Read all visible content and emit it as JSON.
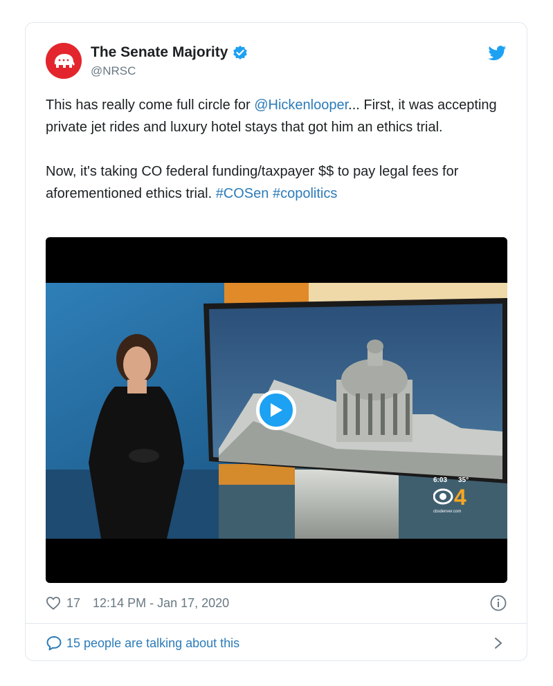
{
  "author": {
    "name": "The Senate Majority",
    "handle": "@NRSC",
    "avatar_icon": "elephant-logo-icon",
    "brand_color": "#e3262d",
    "verified": true
  },
  "tweet": {
    "paragraph1": {
      "before": "This has really come full circle for ",
      "mention": "@Hickenlooper",
      "after": "... First, it was accepting private jet rides and luxury hotel stays that got him an ethics trial."
    },
    "paragraph2": {
      "before": "Now, it's taking CO federal funding/taxpayer $$ to pay legal fees for aforementioned ethics trial. ",
      "hashtag1": "#COSen",
      "hashtag2": "#copolitics"
    },
    "link_color": "#2b7bb9"
  },
  "media": {
    "type": "video",
    "play_icon": "play-icon",
    "station_bug": {
      "time": "6:03",
      "temperature": "35°",
      "logo": "CBS4",
      "site": "cbsdenver.com"
    }
  },
  "footer": {
    "likes": "17",
    "timestamp": "12:14 PM - Jan 17, 2020",
    "conversation": "15 people are talking about this"
  },
  "colors": {
    "twitter_blue": "#1da1f2",
    "text": "#1c2022",
    "secondary": "#697882",
    "border": "#e1e8ed"
  }
}
